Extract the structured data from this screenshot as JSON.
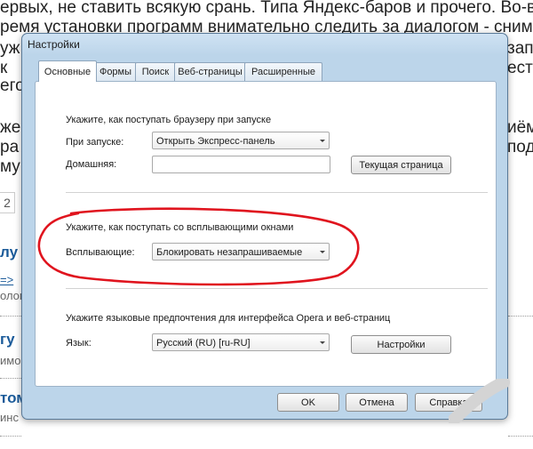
{
  "background": {
    "lines": [
      "ервых, не ставить всякую срань. Типа Яндекс-баров и прочего. Во-в",
      "ремя установки программ внимательно следить за диалогом - снима",
      "уж",
      "к",
      "его",
      "же",
      "ра",
      "му"
    ],
    "right_fragments": [
      "запр",
      "естр",
      "иём",
      "пода"
    ],
    "page_number": "2",
    "sidebar_fragments": [
      "лу",
      "=>",
      "олог",
      "гу",
      "имо",
      "том",
      "инс"
    ]
  },
  "dialog": {
    "title": "Настройки",
    "tabs": [
      "Основные",
      "Формы",
      "Поиск",
      "Веб-страницы",
      "Расширенные"
    ],
    "active_tab": "Основные",
    "startup": {
      "heading": "Укажите, как поступать браузеру при запуске",
      "on_start_label": "При запуске:",
      "on_start_value": "Открыть Экспресс-панель",
      "home_label": "Домашняя:",
      "home_value": "",
      "current_page_button": "Текущая страница"
    },
    "popups": {
      "heading": "Укажите, как поступать со всплывающими окнами",
      "label": "Всплывающие:",
      "value": "Блокировать незапрашиваемые"
    },
    "language": {
      "heading": "Укажите языковые предпочтения для интерфейса Opera и веб-страниц",
      "label": "Язык:",
      "value": "Русский (RU) [ru-RU]",
      "settings_button": "Настройки"
    },
    "footer": {
      "ok": "OK",
      "cancel": "Отмена",
      "help": "Справка"
    }
  },
  "colors": {
    "annotation": "#e0141e",
    "dialog_frame": "#bcd5ea",
    "link": "#1a5a99"
  }
}
